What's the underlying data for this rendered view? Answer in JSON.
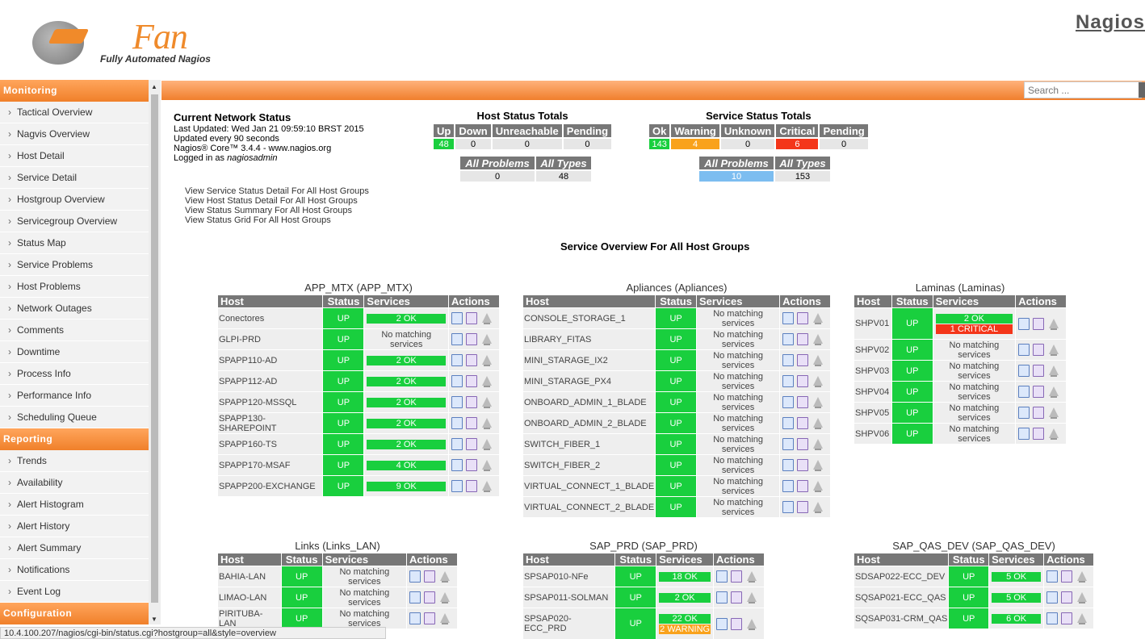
{
  "brand": {
    "logo_title": "Fan",
    "logo_subtitle": "Fully Automated Nagios",
    "product": "Nagios"
  },
  "search": {
    "placeholder": "Search ..."
  },
  "status_url": "10.4.100.207/nagios/cgi-bin/status.cgi?hostgroup=all&style=overview",
  "sidebar": {
    "monitoring_header": "Monitoring",
    "monitoring": [
      "Tactical Overview",
      "Nagvis Overview",
      "Host Detail",
      "Service Detail",
      "Hostgroup Overview",
      "Servicegroup Overview",
      "Status Map",
      "Service Problems",
      "Host Problems",
      "Network Outages",
      "Comments",
      "Downtime",
      "Process Info",
      "Performance Info",
      "Scheduling Queue"
    ],
    "reporting_header": "Reporting",
    "reporting": [
      "Trends",
      "Availability",
      "Alert Histogram",
      "Alert History",
      "Alert Summary",
      "Notifications",
      "Event Log"
    ],
    "configuration_header": "Configuration"
  },
  "info": {
    "title": "Current Network Status",
    "updated": "Last Updated: Wed Jan 21 09:59:10 BRST 2015",
    "interval": "Updated every 90 seconds",
    "version": "Nagios® Core™ 3.4.4 - www.nagios.org",
    "login_prefix": "Logged in as ",
    "user": "nagiosadmin"
  },
  "links": [
    "View Service Status Detail For All Host Groups",
    "View Host Status Detail For All Host Groups",
    "View Status Summary For All Host Groups",
    "View Status Grid For All Host Groups"
  ],
  "host_totals": {
    "title": "Host Status Totals",
    "headers": [
      "Up",
      "Down",
      "Unreachable",
      "Pending"
    ],
    "values": [
      "48",
      "0",
      "0",
      "0"
    ],
    "sum_headers": [
      "All Problems",
      "All Types"
    ],
    "sum_values": [
      "0",
      "48"
    ]
  },
  "service_totals": {
    "title": "Service Status Totals",
    "headers": [
      "Ok",
      "Warning",
      "Unknown",
      "Critical",
      "Pending"
    ],
    "values": [
      "143",
      "4",
      "0",
      "6",
      "0"
    ],
    "sum_headers": [
      "All Problems",
      "All Types"
    ],
    "sum_values": [
      "10",
      "153"
    ]
  },
  "overview_title": "Service Overview For All Host Groups",
  "columns": {
    "host": "Host",
    "status": "Status",
    "services": "Services",
    "actions": "Actions"
  },
  "status_up": "UP",
  "no_services": "No matching services",
  "groups": [
    {
      "id": "app",
      "title": "APP_MTX",
      "alias": "(APP_MTX)",
      "rows": [
        {
          "host": "Conectores",
          "svc": [
            [
              "2 OK",
              "g"
            ]
          ]
        },
        {
          "host": "GLPI-PRD",
          "svc": []
        },
        {
          "host": "SPAPP110-AD",
          "svc": [
            [
              "2 OK",
              "g"
            ]
          ]
        },
        {
          "host": "SPAPP112-AD",
          "svc": [
            [
              "2 OK",
              "g"
            ]
          ]
        },
        {
          "host": "SPAPP120-MSSQL",
          "svc": [
            [
              "2 OK",
              "g"
            ]
          ]
        },
        {
          "host": "SPAPP130-SHAREPOINT",
          "svc": [
            [
              "2 OK",
              "g"
            ]
          ]
        },
        {
          "host": "SPAPP160-TS",
          "svc": [
            [
              "2 OK",
              "g"
            ]
          ]
        },
        {
          "host": "SPAPP170-MSAF",
          "svc": [
            [
              "4 OK",
              "g"
            ]
          ]
        },
        {
          "host": "SPAPP200-EXCHANGE",
          "svc": [
            [
              "9 OK",
              "g"
            ]
          ]
        }
      ]
    },
    {
      "id": "apl",
      "title": "Apliances",
      "alias": "(Apliances)",
      "rows": [
        {
          "host": "CONSOLE_STORAGE_1",
          "svc": []
        },
        {
          "host": "LIBRARY_FITAS",
          "svc": []
        },
        {
          "host": "MINI_STARAGE_IX2",
          "svc": []
        },
        {
          "host": "MINI_STARAGE_PX4",
          "svc": []
        },
        {
          "host": "ONBOARD_ADMIN_1_BLADE",
          "svc": []
        },
        {
          "host": "ONBOARD_ADMIN_2_BLADE",
          "svc": []
        },
        {
          "host": "SWITCH_FIBER_1",
          "svc": []
        },
        {
          "host": "SWITCH_FIBER_2",
          "svc": []
        },
        {
          "host": "VIRTUAL_CONNECT_1_BLADE",
          "svc": []
        },
        {
          "host": "VIRTUAL_CONNECT_2_BLADE",
          "svc": []
        }
      ]
    },
    {
      "id": "lam",
      "title": "Laminas",
      "alias": "(Laminas)",
      "rows": [
        {
          "host": "SHPV01",
          "svc": [
            [
              "2 OK",
              "g"
            ],
            [
              "1 CRITICAL",
              "r"
            ]
          ]
        },
        {
          "host": "SHPV02",
          "svc": []
        },
        {
          "host": "SHPV03",
          "svc": []
        },
        {
          "host": "SHPV04",
          "svc": []
        },
        {
          "host": "SHPV05",
          "svc": []
        },
        {
          "host": "SHPV06",
          "svc": []
        }
      ]
    },
    {
      "id": "lnk",
      "title": "Links",
      "alias": "(Links_LAN)",
      "rows": [
        {
          "host": "BAHIA-LAN",
          "svc": []
        },
        {
          "host": "LIMAO-LAN",
          "svc": []
        },
        {
          "host": "PIRITUBA-LAN",
          "svc": []
        }
      ]
    },
    {
      "id": "sap",
      "title": "SAP_PRD",
      "alias": "(SAP_PRD)",
      "rows": [
        {
          "host": "SPSAP010-NFe",
          "svc": [
            [
              "18 OK",
              "g"
            ]
          ]
        },
        {
          "host": "SPSAP011-SOLMAN",
          "svc": [
            [
              "2 OK",
              "g"
            ]
          ]
        },
        {
          "host": "SPSAP020-ECC_PRD",
          "svc": [
            [
              "22 OK",
              "g"
            ],
            [
              "2 WARNING",
              "o"
            ]
          ]
        }
      ]
    },
    {
      "id": "qas",
      "title": "SAP_QAS_DEV",
      "alias": "(SAP_QAS_DEV)",
      "rows": [
        {
          "host": "SDSAP022-ECC_DEV",
          "svc": [
            [
              "5 OK",
              "g"
            ]
          ]
        },
        {
          "host": "SQSAP021-ECC_QAS",
          "svc": [
            [
              "5 OK",
              "g"
            ]
          ]
        },
        {
          "host": "SQSAP031-CRM_QAS",
          "svc": [
            [
              "6 OK",
              "g"
            ]
          ]
        }
      ]
    }
  ]
}
